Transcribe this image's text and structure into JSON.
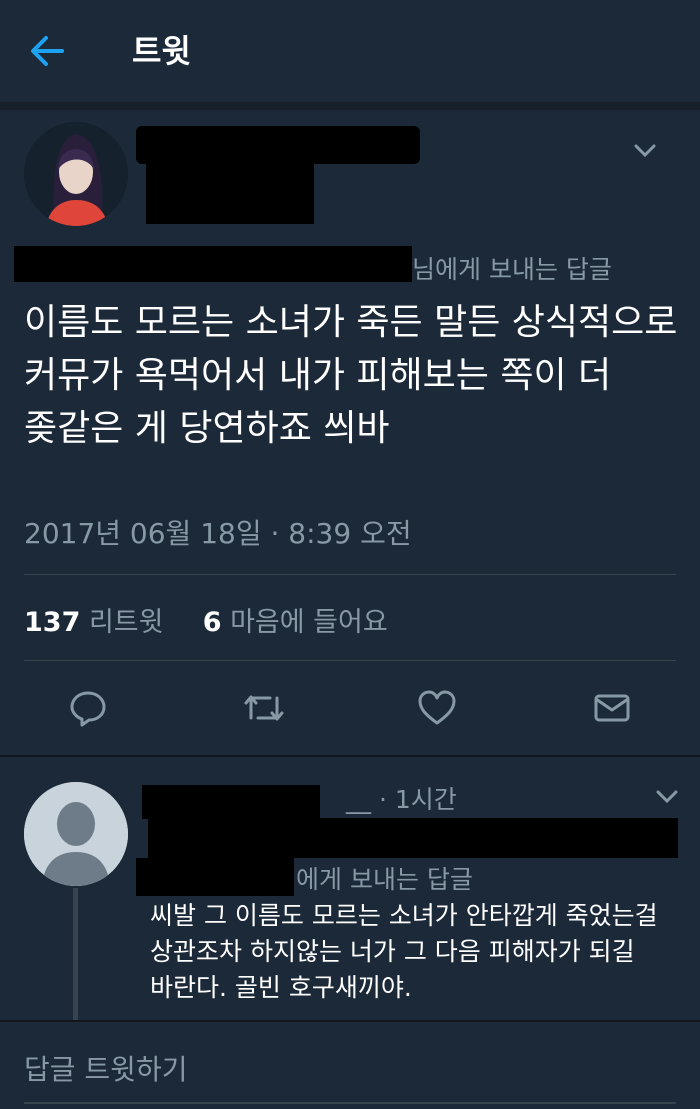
{
  "header": {
    "title": "트윗",
    "back_icon": "arrow-left-icon",
    "accent": "#1da1f2"
  },
  "tweet": {
    "reply_to_suffix": "님에게 보내는 답글",
    "text": "이름도 모르는 소녀가 죽든 말든 상식적으로 커뮤가 욕먹어서 내가 피해보는 쪽이 더 좆같은 게 당연하죠 씌바",
    "timestamp": "2017년 06월 18일 · 8:39 오전",
    "retweets_count": "137",
    "retweets_label": "리트윗",
    "likes_count": "6",
    "likes_label": "마음에 들어요",
    "actions": [
      "reply-icon",
      "retweet-icon",
      "like-icon",
      "direct-message-icon"
    ]
  },
  "reply": {
    "handle_visible": "__",
    "time": "· 1시간",
    "reply_to_suffix": "에게 보내는 답글",
    "text": "씨발 그 이름도 모르는 소녀가 안타깝게 죽었는걸 상관조차 하지않는 너가 그 다음 피해자가 되길 바란다. 골빈 호구새끼야."
  },
  "compose": {
    "placeholder": "답글 트윗하기"
  },
  "colors": {
    "background": "#1c2938",
    "muted_text": "#8899a6",
    "divider": "#38444d"
  }
}
